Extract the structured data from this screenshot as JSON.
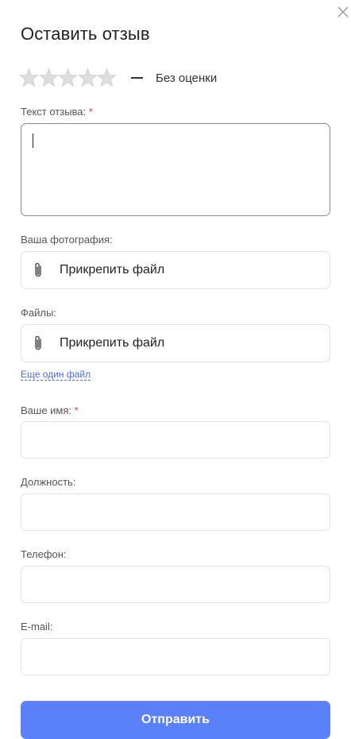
{
  "dialog": {
    "title": "Оставить отзыв",
    "close_icon": "close-icon"
  },
  "rating": {
    "stars_total": 5,
    "stars_selected": 0,
    "star_color": "#dddddd",
    "status_text": "Без оценки"
  },
  "form": {
    "review_text": {
      "label": "Текст отзыва:",
      "required_mark": "*",
      "value": ""
    },
    "photo": {
      "label": "Ваша фотография:",
      "button_label": "Прикрепить файл",
      "icon": "paperclip-icon"
    },
    "files": {
      "label": "Файлы:",
      "button_label": "Прикрепить файл",
      "icon": "paperclip-icon",
      "add_more_link": "Еще один файл"
    },
    "name": {
      "label": "Ваше имя:",
      "required_mark": "*",
      "value": ""
    },
    "position": {
      "label": "Должность:",
      "value": ""
    },
    "phone": {
      "label": "Телефон:",
      "value": ""
    },
    "email": {
      "label": "E-mail:",
      "value": ""
    },
    "submit_label": "Отправить"
  },
  "colors": {
    "accent": "#5b80fc",
    "link": "#4a6cf7",
    "required": "#e0393e"
  }
}
